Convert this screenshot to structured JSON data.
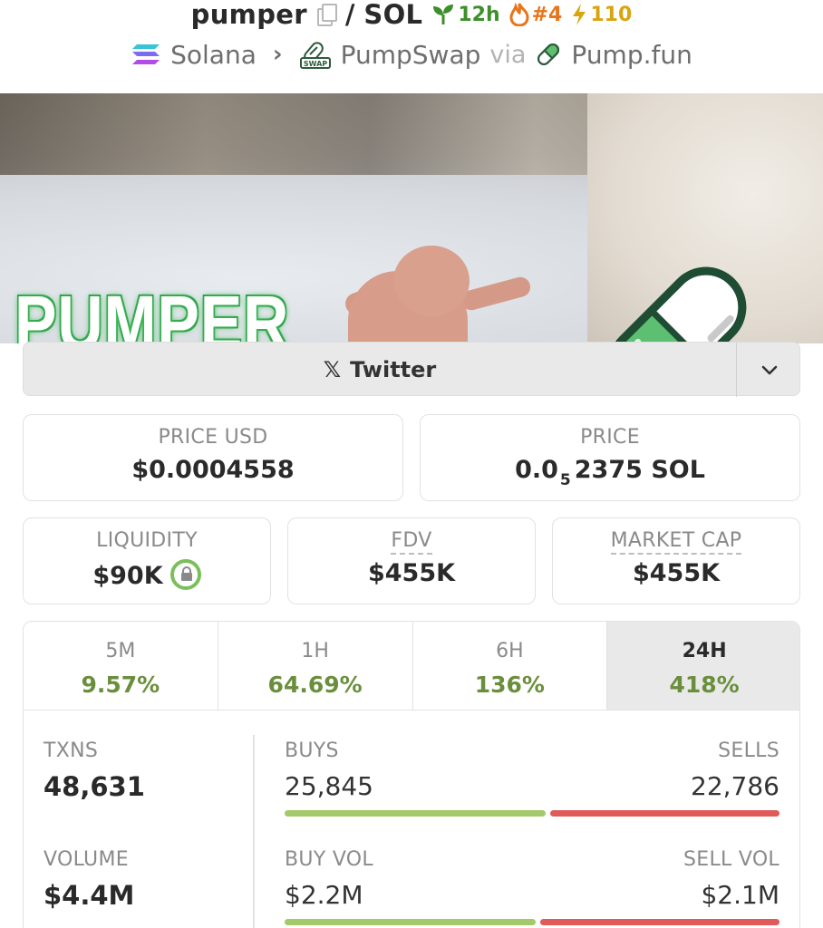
{
  "header": {
    "token": "pumper",
    "quote": "SOL",
    "separator": "/",
    "age": "12h",
    "rank": "#4",
    "boosts": "110"
  },
  "breadcrumb": {
    "chain": "Solana",
    "dex": "PumpSwap",
    "via_label": "via",
    "launchpad": "Pump.fun"
  },
  "banner": {
    "brand_text": "PUMPER"
  },
  "socials": {
    "twitter_label": "Twitter"
  },
  "stats": {
    "price_usd": {
      "label": "PRICE USD",
      "value": "$0.0004558"
    },
    "price": {
      "label": "PRICE",
      "prefix": "0.0",
      "zero_count": "5",
      "digits": "2375",
      "unit": "SOL"
    },
    "liquidity": {
      "label": "LIQUIDITY",
      "value": "$90K"
    },
    "fdv": {
      "label": "FDV",
      "value": "$455K"
    },
    "market_cap": {
      "label": "MARKET CAP",
      "value": "$455K"
    }
  },
  "timeframes": [
    {
      "label": "5M",
      "change": "9.57%"
    },
    {
      "label": "1H",
      "change": "64.69%"
    },
    {
      "label": "6H",
      "change": "136%"
    },
    {
      "label": "24H",
      "change": "418%"
    }
  ],
  "active_timeframe": "24H",
  "trading": {
    "txns": {
      "label": "TXNS",
      "value": "48,631"
    },
    "buys": {
      "label": "BUYS",
      "value": "25,845"
    },
    "sells": {
      "label": "SELLS",
      "value": "22,786"
    },
    "volume": {
      "label": "VOLUME",
      "value": "$4.4M"
    },
    "buy_vol": {
      "label": "BUY VOL",
      "value": "$2.2M"
    },
    "sell_vol": {
      "label": "SELL VOL",
      "value": "$2.1M"
    },
    "buy_share_txns": 0.5315,
    "buy_share_volume": 0.5116
  },
  "colors": {
    "positive": "#6a8f3c",
    "buy_bar": "#a3c96a",
    "sell_bar": "#e05a5a",
    "age_green": "#3c8f2b",
    "rank_orange": "#e8751a",
    "boost_gold": "#d9a50f"
  },
  "icons": [
    "copy-icon",
    "seedling-icon",
    "flame-icon",
    "lightning-icon",
    "solana-icon",
    "pumpswap-icon",
    "chevron-right-icon",
    "pill-icon",
    "x-logo-icon",
    "chevron-down-icon",
    "lock-icon"
  ]
}
